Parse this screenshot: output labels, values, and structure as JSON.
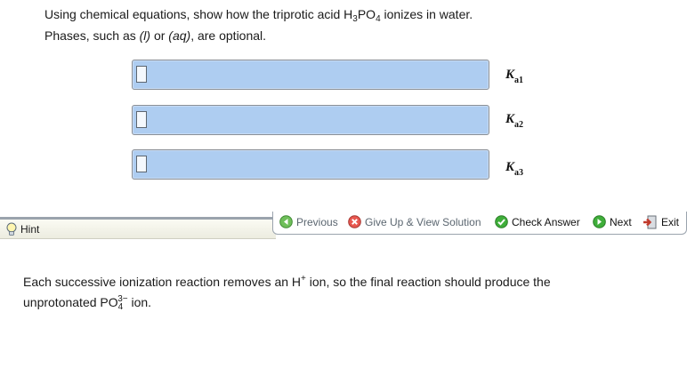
{
  "question": {
    "line1_a": "Using chemical equations, show how the triprotic acid H",
    "line1_sub1": "3",
    "line1_b": "PO",
    "line1_sub2": "4",
    "line1_c": " ionizes in water.",
    "line2_a": "Phases, such as ",
    "line2_b": "(l)",
    "line2_c": " or ",
    "line2_d": "(aq)",
    "line2_e": ", are optional."
  },
  "answers": [
    {
      "k": "K",
      "sub": "a1"
    },
    {
      "k": "K",
      "sub": "a2"
    },
    {
      "k": "K",
      "sub": "a3"
    }
  ],
  "toolbar": {
    "hint": "Hint",
    "previous": "Previous",
    "give_up": "Give Up & View Solution",
    "check": "Check Answer",
    "next": "Next",
    "exit": "Exit"
  },
  "feedback": {
    "line1_a": "Each successive ionization reaction removes an H",
    "line1_sup": "+",
    "line1_b": " ion, so the final reaction should produce the",
    "line2_a": "unprotonated PO",
    "line2_sub": "4",
    "line2_sup": "3−",
    "line2_b": " ion."
  },
  "colors": {
    "input_fill": "#aecdf1",
    "check_green": "#2ca02c",
    "giveup_red": "#d9534f",
    "exit_red": "#c0392b"
  }
}
